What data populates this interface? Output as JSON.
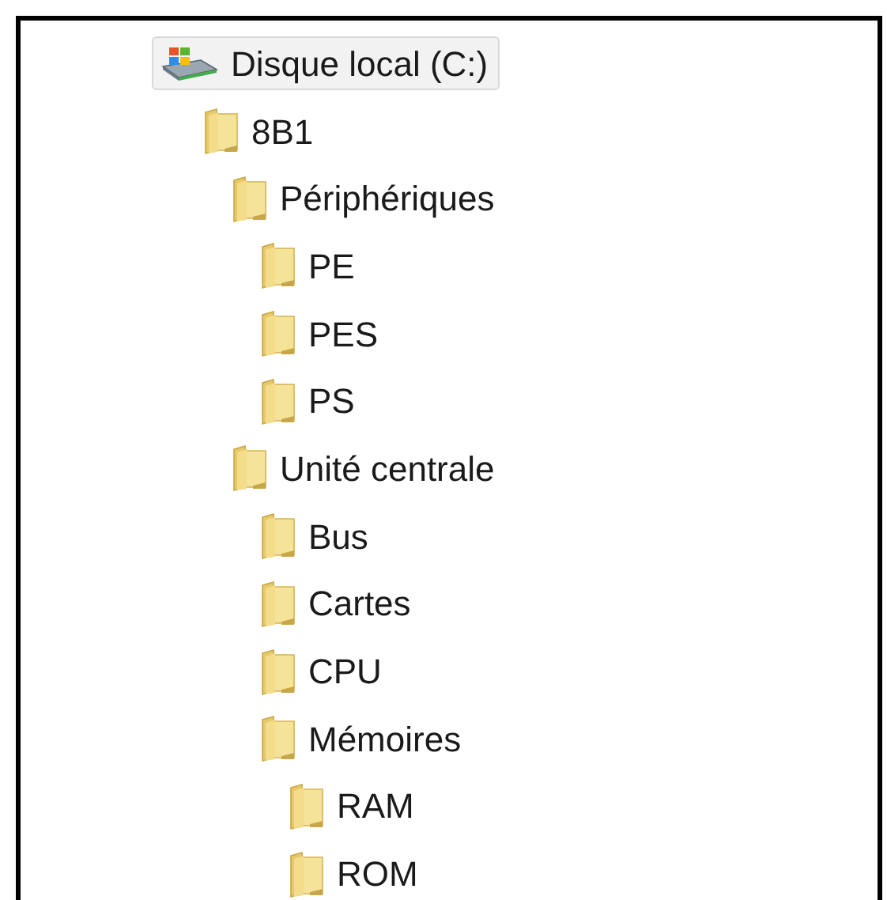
{
  "tree": [
    {
      "label": "Disque local (C:)",
      "kind": "drive",
      "selected": true,
      "children": [
        {
          "label": "8B1",
          "kind": "folder",
          "selected": false,
          "children": [
            {
              "label": "Périphériques",
              "kind": "folder",
              "selected": false,
              "children": [
                {
                  "label": "PE",
                  "kind": "folder",
                  "selected": false
                },
                {
                  "label": "PES",
                  "kind": "folder",
                  "selected": false
                },
                {
                  "label": "PS",
                  "kind": "folder",
                  "selected": false
                }
              ]
            },
            {
              "label": "Unité centrale",
              "kind": "folder",
              "selected": false,
              "children": [
                {
                  "label": "Bus",
                  "kind": "folder",
                  "selected": false
                },
                {
                  "label": "Cartes",
                  "kind": "folder",
                  "selected": false
                },
                {
                  "label": "CPU",
                  "kind": "folder",
                  "selected": false
                },
                {
                  "label": "Mémoires",
                  "kind": "folder",
                  "selected": false,
                  "children": [
                    {
                      "label": "RAM",
                      "kind": "folder",
                      "selected": false
                    },
                    {
                      "label": "ROM",
                      "kind": "folder",
                      "selected": false
                    }
                  ]
                }
              ]
            }
          ]
        }
      ]
    }
  ]
}
